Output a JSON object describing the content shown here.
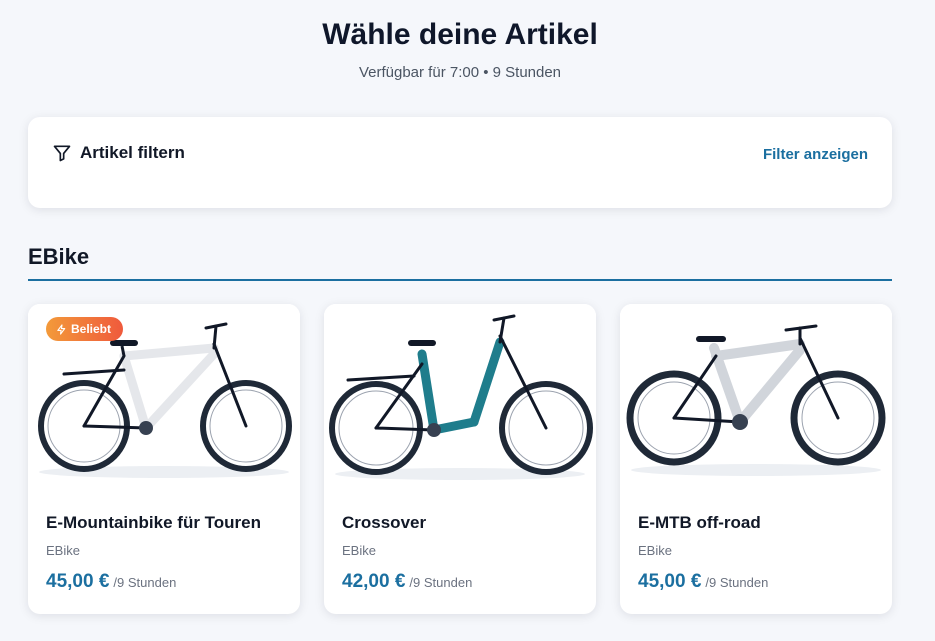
{
  "header": {
    "title": "Wähle deine Artikel",
    "subtitle": "Verfügbar für 7:00 • 9 Stunden"
  },
  "filter": {
    "label": "Artikel filtern",
    "icon": "filter-icon",
    "link": "Filter anzeigen"
  },
  "section": {
    "title": "EBike",
    "accent": "#1b6fa0"
  },
  "products": [
    {
      "name": "E-Mountainbike für Touren",
      "category": "EBike",
      "price": "45,00 €",
      "unit": "/9 Stunden",
      "badge": "Beliebt",
      "frame_color": "#e5e7eb"
    },
    {
      "name": "Crossover",
      "category": "EBike",
      "price": "42,00 €",
      "unit": "/9 Stunden",
      "frame_color": "#1f7d8c"
    },
    {
      "name": "E-MTB off-road",
      "category": "EBike",
      "price": "45,00 €",
      "unit": "/9 Stunden",
      "frame_color": "#d1d5db"
    }
  ]
}
